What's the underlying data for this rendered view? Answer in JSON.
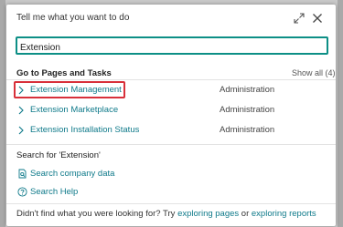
{
  "dialog": {
    "title": "Tell me what you want to do",
    "icons": {
      "expand": "expand-diagonal-icon",
      "close": "close-icon"
    }
  },
  "search": {
    "value": "Extension",
    "placeholder": ""
  },
  "pages_section": {
    "heading": "Go to Pages and Tasks",
    "show_all": "Show all (4)",
    "results": [
      {
        "label": "Extension Management",
        "category": "Administration",
        "highlighted": true
      },
      {
        "label": "Extension Marketplace",
        "category": "Administration",
        "highlighted": false
      },
      {
        "label": "Extension Installation Status",
        "category": "Administration",
        "highlighted": false
      }
    ]
  },
  "search_section": {
    "heading": "Search for 'Extension'",
    "actions": [
      {
        "label": "Search company data",
        "icon": "document-search-icon"
      },
      {
        "label": "Search Help",
        "icon": "help-circle-icon"
      }
    ]
  },
  "footer": {
    "prefix": "Didn't find what you were looking for? Try ",
    "link1": "exploring pages",
    "middle": " or ",
    "link2": "exploring reports"
  },
  "colors": {
    "accent": "#0d8f86",
    "link": "#0f7a8a",
    "highlight_border": "#d8303a"
  }
}
